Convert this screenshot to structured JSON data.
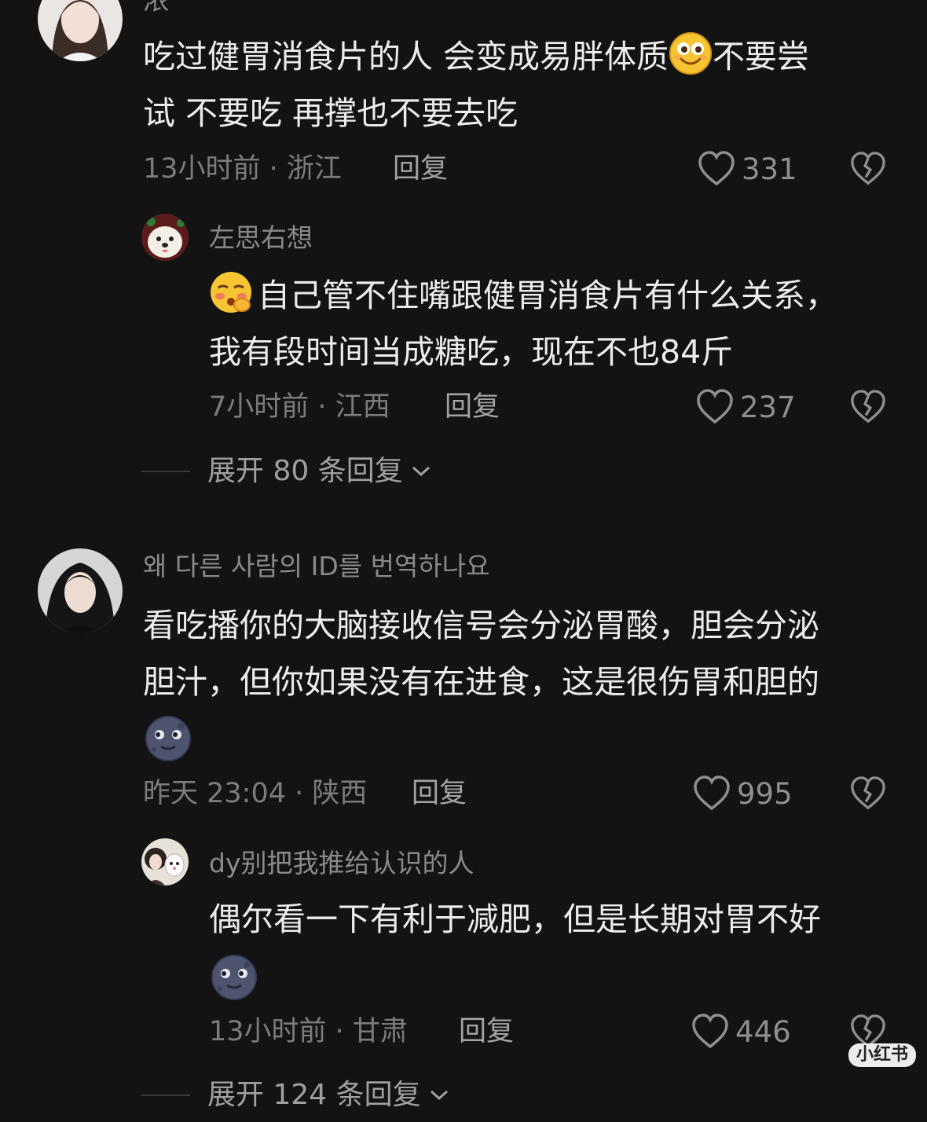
{
  "comments": [
    {
      "username": "浓",
      "text_line1_a": "吃过健胃消食片的人 会变成易胖体质",
      "text_line1_b": "不要尝",
      "text_line2": "试 不要吃 再撑也不要去吃",
      "emoji": "smiling-face-emoji",
      "meta": "13小时前 · 浙江",
      "reply_label": "回复",
      "likes": "331",
      "replies": [
        {
          "username": "左思右想",
          "emoji": "blushing-face-emoji",
          "text_line1": "自己管不住嘴跟健胃消食片有什么关系，",
          "text_line2": "我有段时间当成糖吃，现在不也84斤",
          "meta": "7小时前 · 江西",
          "reply_label": "回复",
          "likes": "237"
        }
      ],
      "expand_label": "展开 80 条回复"
    },
    {
      "username": "왜 다른 사람의 ID를 번역하나요",
      "text_line1": "看吃播你的大脑接收信号会分泌胃酸，胆会分泌",
      "text_line2": "胆汁，但你如果没有在进食，这是很伤胃和胆的",
      "emoji": "new-moon-face-emoji",
      "meta": "昨天 23:04 · 陕西",
      "reply_label": "回复",
      "likes": "995",
      "replies": [
        {
          "username": "dy别把我推给认识的人",
          "text_line1": "偶尔看一下有利于减肥，但是长期对胃不好",
          "emoji": "new-moon-face-emoji",
          "meta": "13小时前 · 甘肃",
          "reply_label": "回复",
          "likes": "446"
        }
      ],
      "expand_label": "展开 124 条回复"
    }
  ],
  "watermark": "小红书",
  "icons": {
    "like": "heart-outline-icon",
    "dislike": "broken-heart-icon",
    "expand": "chevron-down-icon"
  }
}
